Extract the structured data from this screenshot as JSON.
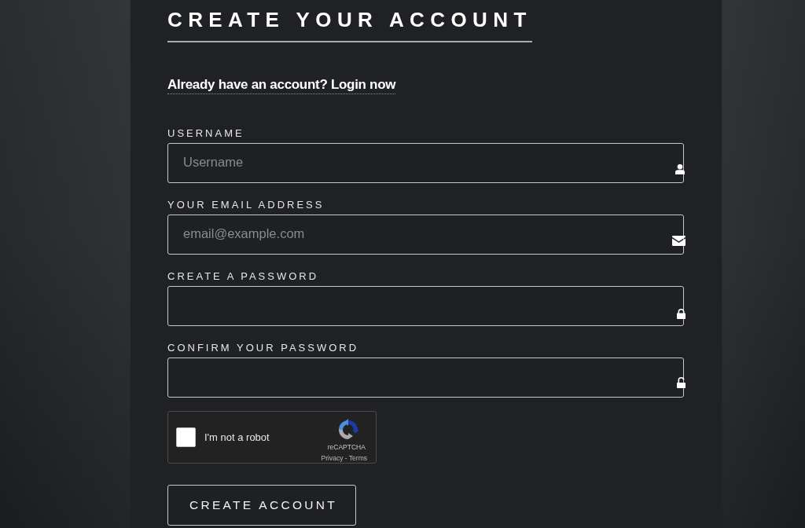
{
  "title": "CREATE YOUR ACCOUNT",
  "login_link": "Already have an account? Login now",
  "fields": [
    {
      "kind": "username",
      "label": "USERNAME",
      "placeholder": "Username"
    },
    {
      "kind": "email",
      "label": "YOUR EMAIL ADDRESS",
      "placeholder": "email@example.com"
    },
    {
      "kind": "password",
      "label": "CREATE A PASSWORD"
    },
    {
      "kind": "confirm_password",
      "label": "CONFIRM YOUR PASSWORD"
    }
  ],
  "captcha": {
    "checked": false,
    "label": "I'm not a robot",
    "brand": "reCAPTCHA",
    "footer": "Privacy - Terms"
  },
  "submit_button": "CREATE ACCOUNT"
}
